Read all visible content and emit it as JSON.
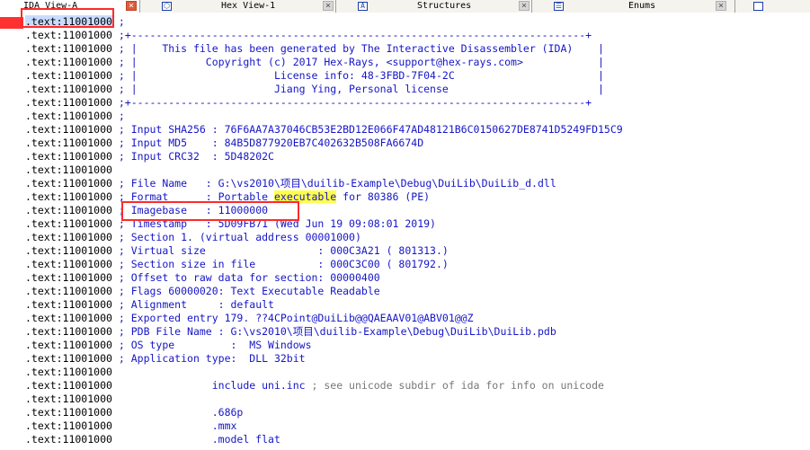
{
  "tabs": [
    {
      "label": "IDA View-A",
      "icon": "",
      "close": "×"
    },
    {
      "label": "Hex View-1",
      "icon": "⬡",
      "close": "×"
    },
    {
      "label": "Structures",
      "icon": "A",
      "close": "×"
    },
    {
      "label": "Enums",
      "icon": "☰",
      "close": "×"
    }
  ],
  "listing": {
    "address_first": ".text:11001000",
    "address": ".text:11001000",
    "border_line": ";+-------------------------------------------------------------------------+",
    "banner": [
      "; |    This file has been generated by The Interactive Disassembler (IDA)    |",
      "; |           Copyright (c) 2017 Hex-Rays, <support@hex-rays.com>            |",
      "; |                      License info: 48-3FBD-7F04-2C                       |",
      "; |                      Jiang Ying, Personal license                        |"
    ],
    "semicolon": ";",
    "sha256": "; Input SHA256 : 76F6AA7A37046CB53E2BD12E066F47AD48121B6C0150627DE8741D5249FD15C9",
    "md5": "; Input MD5    : 84B5D877920EB7C402632B508FA6674D",
    "crc32": "; Input CRC32  : 5D48202C",
    "file_name": "; File Name   : G:\\vs2010\\项目\\duilib-Example\\Debug\\DuiLib\\DuiLib_d.dll",
    "format_prefix": "; Format      : Portable ",
    "format_highlight": "executable",
    "format_suffix": " for 80386 (PE)",
    "imagebase": "; Imagebase   : 11000000",
    "timestamp": "; Timestamp   : 5D09FB71 (Wed Jun 19 09:08:01 2019)",
    "section": "; Section 1. (virtual address 00001000)",
    "virtual_size": "; Virtual size                  : 000C3A21 ( 801313.)",
    "section_size": "; Section size in file          : 000C3C00 ( 801792.)",
    "raw_offset": "; Offset to raw data for section: 00000400",
    "flags": "; Flags 60000020: Text Executable Readable",
    "alignment": "; Alignment     : default",
    "exported_entry": "; Exported entry 179. ??4CPoint@DuiLib@@QAEAAV01@ABV01@@Z",
    "pdb": "; PDB File Name : G:\\vs2010\\项目\\duilib-Example\\Debug\\DuiLib\\DuiLib.pdb",
    "os_type": "; OS type         :  MS Windows",
    "app_type": "; Application type:  DLL 32bit",
    "include": "include uni.inc",
    "include_comment": " ; see unicode subdir of ida for info on unicode",
    "p686": ".686p",
    "mmx": ".mmx",
    "model": ".model flat"
  },
  "colors": {
    "comment": "#1515c8",
    "highlight": "#ffff4a",
    "annotation": "#ff2a2a"
  }
}
